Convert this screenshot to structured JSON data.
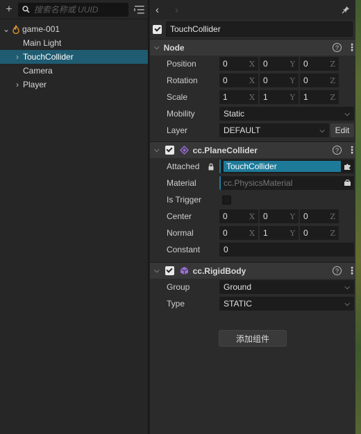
{
  "hierarchy": {
    "search_placeholder": "搜索名称或 UUID",
    "items": [
      {
        "label": "game-001",
        "depth": 0,
        "arrow": "down",
        "icon": "scene-flame-icon"
      },
      {
        "label": "Main Light",
        "depth": 1,
        "arrow": "none"
      },
      {
        "label": "TouchCollider",
        "depth": 1,
        "arrow": "right",
        "selected": true
      },
      {
        "label": "Camera",
        "depth": 1,
        "arrow": "none"
      },
      {
        "label": "Player",
        "depth": 1,
        "arrow": "right"
      }
    ]
  },
  "inspector": {
    "node_name": "TouchCollider",
    "node_section": {
      "title": "Node",
      "position": {
        "label": "Position",
        "x": "0",
        "y": "0",
        "z": "0"
      },
      "rotation": {
        "label": "Rotation",
        "x": "0",
        "y": "0",
        "z": "0"
      },
      "scale": {
        "label": "Scale",
        "x": "1",
        "y": "1",
        "z": "1"
      },
      "mobility": {
        "label": "Mobility",
        "value": "Static"
      },
      "layer": {
        "label": "Layer",
        "value": "DEFAULT",
        "edit": "Edit"
      }
    },
    "plane_collider": {
      "title": "cc.PlaneCollider",
      "attached": {
        "label": "Attached",
        "value": "TouchCollider"
      },
      "material": {
        "label": "Material",
        "value": "cc.PhysicsMaterial"
      },
      "is_trigger": {
        "label": "Is Trigger"
      },
      "center": {
        "label": "Center",
        "x": "0",
        "y": "0",
        "z": "0"
      },
      "normal": {
        "label": "Normal",
        "x": "0",
        "y": "1",
        "z": "0"
      },
      "constant": {
        "label": "Constant",
        "value": "0"
      }
    },
    "rigid_body": {
      "title": "cc.RigidBody",
      "group": {
        "label": "Group",
        "value": "Ground"
      },
      "type": {
        "label": "Type",
        "value": "STATIC"
      }
    },
    "add_component": "添加组件",
    "axes": {
      "x": "X",
      "y": "Y",
      "z": "Z"
    }
  },
  "colors": {
    "selection": "#1f5c72",
    "accent": "#1e7a99",
    "component_icon": "#9b6ddb"
  }
}
